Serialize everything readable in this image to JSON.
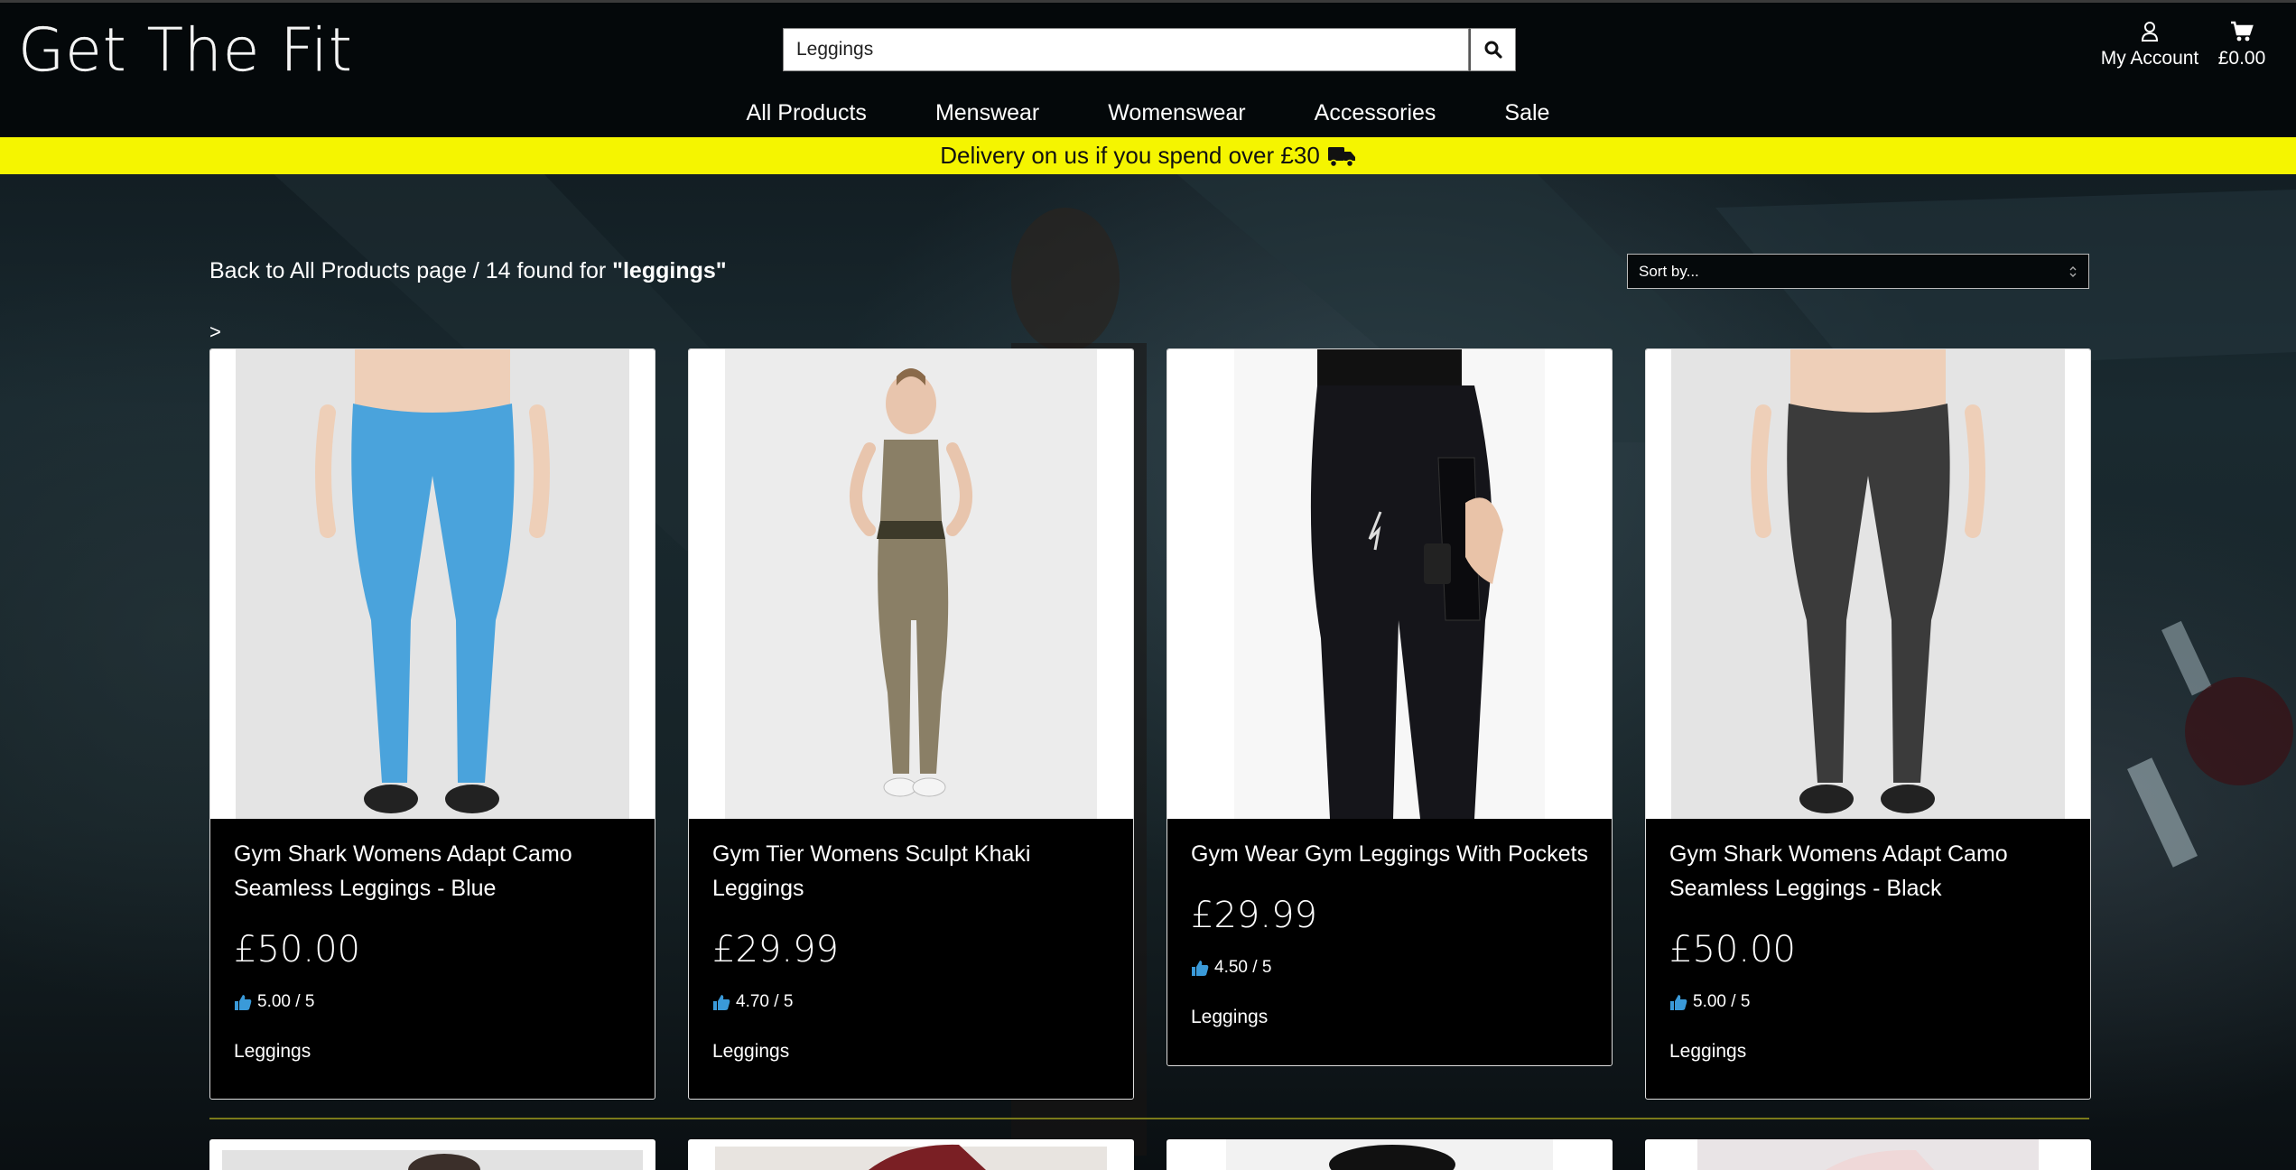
{
  "header": {
    "logo": "Get The Fit",
    "search": {
      "value": "Leggings",
      "placeholder": ""
    },
    "account_label": "My Account",
    "cart_total": "£0.00"
  },
  "nav": {
    "items": [
      {
        "label": "All Products"
      },
      {
        "label": "Menswear"
      },
      {
        "label": "Womenswear"
      },
      {
        "label": "Accessories"
      },
      {
        "label": "Sale"
      }
    ]
  },
  "promo": {
    "text": "Delivery on us if you spend over £30"
  },
  "results": {
    "back_link": "Back to All Products page",
    "separator": " / ",
    "count_text": "14 found for ",
    "query": "\"leggings\"",
    "caret": ">"
  },
  "sort": {
    "selected": "Sort by..."
  },
  "products": [
    {
      "title": "Gym Shark Womens Adapt Camo Seamless Leggings - Blue",
      "price": "£50.00",
      "rating": "5.00 / 5",
      "category": "Leggings",
      "legging_color": "#4aa3dc"
    },
    {
      "title": "Gym Tier Womens Sculpt Khaki Leggings",
      "price": "£29.99",
      "rating": "4.70 / 5",
      "category": "Leggings",
      "legging_color": "#8a7f66"
    },
    {
      "title": "Gym Wear Gym Leggings With Pockets",
      "price": "£29.99",
      "rating": "4.50 / 5",
      "category": "Leggings",
      "legging_color": "#15151a"
    },
    {
      "title": "Gym Shark Womens Adapt Camo Seamless Leggings - Black",
      "price": "£50.00",
      "rating": "5.00 / 5",
      "category": "Leggings",
      "legging_color": "#3b3b3b"
    }
  ],
  "colors": {
    "promo_bg": "#f5f500",
    "header_bg": "#04080a",
    "thumb_icon": "#3a9ad9"
  },
  "icons": {
    "search": "search-icon",
    "account": "user-icon",
    "cart": "cart-icon",
    "delivery": "truck-icon",
    "rating": "thumbs-up-icon"
  }
}
